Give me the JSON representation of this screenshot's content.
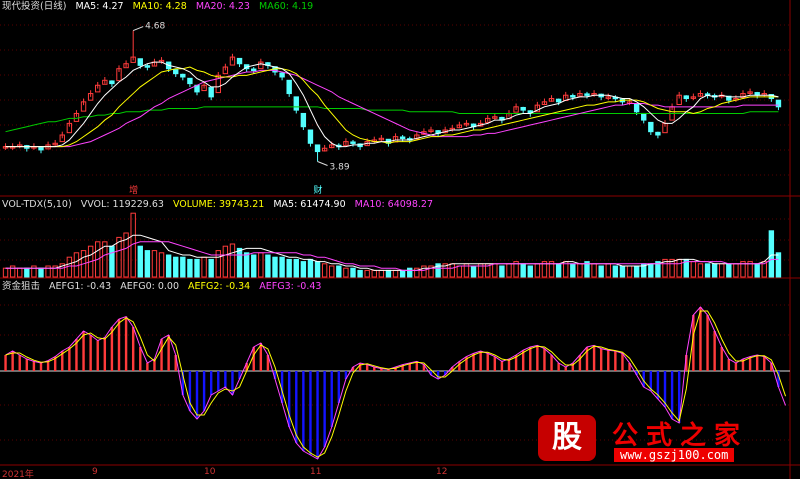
{
  "colors": {
    "up": "#ff3b3b",
    "down": "#54ffff",
    "ma5": "#ffffff",
    "ma10": "#ffff00",
    "ma20": "#ff44ff",
    "ma60": "#00cc00",
    "divider": "#8b0000",
    "blue": "#1414ff"
  },
  "price_header": {
    "title": "现代投资(日线)",
    "ma5": "MA5: 4.27",
    "ma10": "MA10: 4.28",
    "ma20": "MA20: 4.23",
    "ma60": "MA60: 4.19"
  },
  "vol_header": {
    "title": "VOL-TDX(5,10)",
    "vvol": "VVOL: 119229.63",
    "volume": "VOLUME: 39743.21",
    "ma5": "MA5: 61474.90",
    "ma10": "MA10: 64098.27"
  },
  "ind_header": {
    "title": "资金狙击",
    "g1": "AEFG1: -0.43",
    "g0": "AEFG0: 0.00",
    "g2": "AEFG2: -0.34",
    "g3": "AEFG3: -0.43"
  },
  "x_ticks": [
    "2021年",
    "9",
    "10",
    "11",
    "12"
  ],
  "markers": {
    "high": "4.68",
    "low": "3.89",
    "note1": "增",
    "note2": "财"
  },
  "watermark": {
    "char": "股",
    "name": "公式之家",
    "url": "www.gszj100.com"
  },
  "chart_data": [
    {
      "type": "candlestick",
      "title": "现代投资(日线)",
      "ylim": [
        3.7,
        4.78
      ],
      "close": [
        3.98,
        3.98,
        3.99,
        3.97,
        3.98,
        3.96,
        3.99,
        4.0,
        4.05,
        4.12,
        4.18,
        4.25,
        4.3,
        4.35,
        4.38,
        4.36,
        4.45,
        4.48,
        4.52,
        4.47,
        4.46,
        4.49,
        4.5,
        4.45,
        4.42,
        4.4,
        4.36,
        4.31,
        4.35,
        4.28,
        4.41,
        4.46,
        4.52,
        4.48,
        4.45,
        4.44,
        4.49,
        4.47,
        4.43,
        4.4,
        4.3,
        4.2,
        4.1,
        4.0,
        3.95,
        3.97,
        3.99,
        3.98,
        4.01,
        4.0,
        3.98,
        4.01,
        4.02,
        4.03,
        4.0,
        4.04,
        4.03,
        4.02,
        4.05,
        4.07,
        4.08,
        4.06,
        4.08,
        4.09,
        4.11,
        4.12,
        4.1,
        4.12,
        4.15,
        4.16,
        4.14,
        4.18,
        4.22,
        4.2,
        4.18,
        4.23,
        4.25,
        4.27,
        4.25,
        4.29,
        4.28,
        4.3,
        4.29,
        4.3,
        4.28,
        4.28,
        4.27,
        4.25,
        4.25,
        4.19,
        4.14,
        4.07,
        4.05,
        4.12,
        4.22,
        4.29,
        4.27,
        4.28,
        4.3,
        4.29,
        4.28,
        4.29,
        4.26,
        4.27,
        4.3,
        4.31,
        4.29,
        4.3,
        4.27,
        4.22
      ],
      "high": [
        4.0,
        4.0,
        4.01,
        3.99,
        4.0,
        3.98,
        4.01,
        4.02,
        4.07,
        4.14,
        4.2,
        4.27,
        4.32,
        4.37,
        4.4,
        4.38,
        4.47,
        4.5,
        4.68,
        4.49,
        4.48,
        4.51,
        4.52,
        4.47,
        4.44,
        4.42,
        4.38,
        4.33,
        4.37,
        4.3,
        4.43,
        4.48,
        4.54,
        4.5,
        4.47,
        4.46,
        4.51,
        4.49,
        4.45,
        4.42,
        4.32,
        4.22,
        4.12,
        4.02,
        3.97,
        3.99,
        4.01,
        4.0,
        4.03,
        4.02,
        4.0,
        4.03,
        4.04,
        4.05,
        4.02,
        4.06,
        4.05,
        4.04,
        4.07,
        4.09,
        4.1,
        4.08,
        4.1,
        4.11,
        4.13,
        4.14,
        4.12,
        4.14,
        4.17,
        4.18,
        4.16,
        4.2,
        4.24,
        4.22,
        4.2,
        4.25,
        4.27,
        4.29,
        4.27,
        4.31,
        4.3,
        4.32,
        4.31,
        4.32,
        4.3,
        4.3,
        4.29,
        4.27,
        4.27,
        4.21,
        4.16,
        4.09,
        4.07,
        4.14,
        4.24,
        4.31,
        4.29,
        4.3,
        4.32,
        4.31,
        4.3,
        4.31,
        4.28,
        4.29,
        4.32,
        4.33,
        4.31,
        4.32,
        4.29,
        4.24
      ],
      "low": [
        3.96,
        3.96,
        3.97,
        3.95,
        3.96,
        3.94,
        3.97,
        3.98,
        4.03,
        4.1,
        4.16,
        4.23,
        4.28,
        4.33,
        4.36,
        4.34,
        4.43,
        4.46,
        4.5,
        4.45,
        4.44,
        4.47,
        4.48,
        4.43,
        4.4,
        4.38,
        4.34,
        4.29,
        4.33,
        4.26,
        4.39,
        4.44,
        4.5,
        4.46,
        4.43,
        4.42,
        4.47,
        4.45,
        4.41,
        4.38,
        4.28,
        4.18,
        4.08,
        3.98,
        3.89,
        3.95,
        3.97,
        3.96,
        3.99,
        3.98,
        3.96,
        3.99,
        4.0,
        4.01,
        3.98,
        4.02,
        4.01,
        4.0,
        4.03,
        4.05,
        4.06,
        4.04,
        4.06,
        4.07,
        4.09,
        4.1,
        4.08,
        4.1,
        4.13,
        4.14,
        4.12,
        4.16,
        4.2,
        4.18,
        4.16,
        4.21,
        4.23,
        4.25,
        4.23,
        4.27,
        4.26,
        4.28,
        4.27,
        4.28,
        4.26,
        4.26,
        4.25,
        4.23,
        4.23,
        4.17,
        4.12,
        4.05,
        4.03,
        4.1,
        4.2,
        4.27,
        4.25,
        4.26,
        4.28,
        4.27,
        4.26,
        4.27,
        4.24,
        4.25,
        4.28,
        4.29,
        4.27,
        4.28,
        4.25,
        4.2
      ],
      "ma5": [
        3.98,
        3.98,
        3.98,
        3.98,
        3.98,
        3.98,
        3.98,
        3.98,
        3.99,
        4.02,
        4.07,
        4.12,
        4.18,
        4.24,
        4.29,
        4.33,
        4.37,
        4.4,
        4.44,
        4.46,
        4.48,
        4.49,
        4.49,
        4.47,
        4.46,
        4.45,
        4.43,
        4.39,
        4.37,
        4.34,
        4.34,
        4.36,
        4.4,
        4.43,
        4.46,
        4.47,
        4.48,
        4.47,
        4.46,
        4.45,
        4.42,
        4.36,
        4.29,
        4.2,
        4.11,
        4.04,
        4.0,
        3.98,
        3.98,
        3.99,
        3.99,
        4.0,
        4.0,
        4.01,
        4.01,
        4.02,
        4.02,
        4.02,
        4.03,
        4.04,
        4.05,
        4.06,
        4.07,
        4.08,
        4.08,
        4.09,
        4.1,
        4.11,
        4.12,
        4.14,
        4.14,
        4.15,
        4.17,
        4.18,
        4.18,
        4.2,
        4.22,
        4.23,
        4.24,
        4.26,
        4.27,
        4.28,
        4.28,
        4.29,
        4.29,
        4.29,
        4.28,
        4.27,
        4.27,
        4.25,
        4.22,
        4.18,
        4.14,
        4.12,
        4.12,
        4.15,
        4.19,
        4.22,
        4.27,
        4.29,
        4.28,
        4.29,
        4.28,
        4.28,
        4.28,
        4.29,
        4.29,
        4.29,
        4.29,
        4.28
      ],
      "ma10": [
        3.98,
        3.98,
        3.98,
        3.98,
        3.98,
        3.98,
        3.98,
        3.98,
        3.98,
        3.99,
        4.01,
        4.04,
        4.07,
        4.1,
        4.14,
        4.17,
        4.22,
        4.26,
        4.3,
        4.34,
        4.37,
        4.4,
        4.43,
        4.44,
        4.45,
        4.45,
        4.46,
        4.44,
        4.43,
        4.41,
        4.4,
        4.4,
        4.4,
        4.41,
        4.41,
        4.42,
        4.43,
        4.44,
        4.45,
        4.45,
        4.44,
        4.42,
        4.38,
        4.33,
        4.29,
        4.23,
        4.18,
        4.13,
        4.08,
        4.05,
        4.03,
        4.02,
        4.01,
        4.01,
        4.0,
        4.01,
        4.01,
        4.01,
        4.02,
        4.03,
        4.04,
        4.04,
        4.05,
        4.05,
        4.06,
        4.07,
        4.08,
        4.08,
        4.09,
        4.1,
        4.11,
        4.12,
        4.13,
        4.14,
        4.15,
        4.16,
        4.17,
        4.18,
        4.19,
        4.2,
        4.21,
        4.22,
        4.23,
        4.23,
        4.24,
        4.25,
        4.25,
        4.26,
        4.26,
        4.26,
        4.25,
        4.23,
        4.21,
        4.2,
        4.19,
        4.19,
        4.19,
        4.18,
        4.19,
        4.21,
        4.22,
        4.24,
        4.25,
        4.26,
        4.27,
        4.28,
        4.28,
        4.28,
        4.28,
        4.28
      ],
      "ma20": [
        3.98,
        3.98,
        3.98,
        3.98,
        3.98,
        3.98,
        3.98,
        3.98,
        3.98,
        3.98,
        3.99,
        4.0,
        4.01,
        4.03,
        4.05,
        4.07,
        4.09,
        4.12,
        4.14,
        4.16,
        4.19,
        4.22,
        4.24,
        4.27,
        4.29,
        4.31,
        4.33,
        4.35,
        4.37,
        4.38,
        4.39,
        4.4,
        4.41,
        4.42,
        4.43,
        4.43,
        4.44,
        4.44,
        4.44,
        4.43,
        4.42,
        4.41,
        4.39,
        4.37,
        4.35,
        4.33,
        4.31,
        4.28,
        4.26,
        4.24,
        4.22,
        4.2,
        4.18,
        4.16,
        4.14,
        4.12,
        4.1,
        4.08,
        4.07,
        4.06,
        4.05,
        4.04,
        4.04,
        4.04,
        4.04,
        4.04,
        4.05,
        4.05,
        4.06,
        4.06,
        4.07,
        4.08,
        4.09,
        4.1,
        4.11,
        4.12,
        4.13,
        4.14,
        4.15,
        4.16,
        4.17,
        4.18,
        4.19,
        4.2,
        4.21,
        4.22,
        4.23,
        4.23,
        4.24,
        4.24,
        4.24,
        4.23,
        4.23,
        4.22,
        4.22,
        4.22,
        4.22,
        4.22,
        4.22,
        4.22,
        4.22,
        4.22,
        4.22,
        4.22,
        4.23,
        4.23,
        4.23,
        4.23,
        4.23,
        4.23
      ],
      "ma60": [
        4.07,
        4.08,
        4.09,
        4.1,
        4.11,
        4.12,
        4.13,
        4.13,
        4.14,
        4.15,
        4.15,
        4.16,
        4.16,
        4.17,
        4.17,
        4.18,
        4.18,
        4.19,
        4.19,
        4.19,
        4.2,
        4.2,
        4.2,
        4.21,
        4.21,
        4.21,
        4.21,
        4.21,
        4.22,
        4.22,
        4.22,
        4.22,
        4.22,
        4.22,
        4.22,
        4.22,
        4.22,
        4.22,
        4.22,
        4.22,
        4.22,
        4.22,
        4.22,
        4.22,
        4.22,
        4.21,
        4.21,
        4.21,
        4.21,
        4.21,
        4.21,
        4.2,
        4.2,
        4.2,
        4.2,
        4.2,
        4.2,
        4.19,
        4.19,
        4.19,
        4.19,
        4.19,
        4.19,
        4.19,
        4.18,
        4.18,
        4.18,
        4.18,
        4.18,
        4.18,
        4.18,
        4.18,
        4.18,
        4.18,
        4.18,
        4.18,
        4.18,
        4.18,
        4.18,
        4.18,
        4.18,
        4.18,
        4.18,
        4.18,
        4.18,
        4.18,
        4.18,
        4.18,
        4.18,
        4.18,
        4.18,
        4.18,
        4.18,
        4.18,
        4.18,
        4.18,
        4.18,
        4.18,
        4.18,
        4.18,
        4.18,
        4.18,
        4.18,
        4.18,
        4.18,
        4.19,
        4.19,
        4.19,
        4.19,
        4.19
      ]
    },
    {
      "type": "bar",
      "title": "VOL-TDX(5,10)",
      "volume": [
        4,
        5,
        4,
        4,
        5,
        4,
        5,
        5,
        6,
        9,
        11,
        12,
        14,
        16,
        16,
        14,
        18,
        20,
        29,
        14,
        12,
        12,
        11,
        10,
        9,
        9,
        8,
        8,
        9,
        8,
        12,
        14,
        15,
        13,
        11,
        10,
        11,
        10,
        9,
        9,
        8,
        8,
        7,
        8,
        7,
        6,
        5,
        5,
        4,
        4,
        3,
        3,
        3,
        3,
        3,
        3,
        3,
        4,
        4,
        5,
        5,
        6,
        6,
        6,
        5,
        6,
        5,
        6,
        6,
        6,
        5,
        6,
        7,
        6,
        5,
        6,
        7,
        7,
        6,
        7,
        6,
        6,
        7,
        6,
        5,
        6,
        5,
        5,
        5,
        5,
        6,
        6,
        7,
        8,
        8,
        8,
        8,
        7,
        6,
        6,
        6,
        6,
        6,
        6,
        7,
        7,
        6,
        7,
        21,
        11
      ],
      "ma5": [
        4,
        4,
        4,
        4,
        4,
        4,
        4,
        4,
        5,
        6,
        7,
        9,
        10,
        12,
        14,
        14,
        16,
        17,
        19,
        19,
        18,
        17,
        16,
        12,
        11,
        10,
        10,
        9,
        9,
        9,
        9,
        10,
        11,
        12,
        13,
        13,
        13,
        12,
        11,
        10,
        9,
        9,
        8,
        8,
        7,
        7,
        6,
        6,
        5,
        5,
        4,
        4,
        3,
        3,
        3,
        3,
        3,
        3,
        3,
        4,
        4,
        5,
        5,
        6,
        6,
        6,
        6,
        6,
        6,
        6,
        6,
        6,
        6,
        6,
        6,
        6,
        6,
        6,
        6,
        7,
        7,
        6,
        6,
        6,
        6,
        6,
        6,
        5,
        5,
        5,
        5,
        6,
        6,
        7,
        7,
        8,
        8,
        8,
        7,
        7,
        6,
        6,
        6,
        6,
        6,
        6,
        6,
        7,
        10,
        10
      ],
      "ma10": [
        4,
        4,
        4,
        4,
        4,
        4,
        4,
        4,
        4,
        5,
        5,
        6,
        7,
        8,
        10,
        11,
        12,
        13,
        15,
        16,
        16,
        16,
        16,
        16,
        15,
        14,
        13,
        12,
        11,
        10,
        10,
        10,
        10,
        10,
        10,
        11,
        11,
        11,
        11,
        11,
        11,
        11,
        10,
        10,
        9,
        9,
        8,
        7,
        6,
        6,
        5,
        5,
        5,
        4,
        4,
        4,
        3,
        3,
        3,
        3,
        4,
        4,
        4,
        4,
        5,
        5,
        5,
        5,
        5,
        6,
        6,
        6,
        6,
        6,
        6,
        6,
        6,
        6,
        6,
        6,
        6,
        6,
        6,
        6,
        6,
        6,
        6,
        6,
        6,
        6,
        6,
        6,
        6,
        6,
        6,
        6,
        7,
        7,
        7,
        7,
        7,
        7,
        6,
        6,
        6,
        6,
        6,
        6,
        8,
        8
      ]
    },
    {
      "type": "bar",
      "title": "资金狙击",
      "aefg1": [
        0.2,
        0.25,
        0.2,
        0.15,
        0.12,
        0.1,
        0.13,
        0.18,
        0.25,
        0.3,
        0.4,
        0.5,
        0.45,
        0.38,
        0.42,
        0.55,
        0.65,
        0.68,
        0.55,
        0.3,
        0.1,
        0.15,
        0.4,
        0.45,
        0.2,
        -0.3,
        -0.5,
        -0.6,
        -0.5,
        -0.3,
        -0.25,
        -0.2,
        -0.3,
        -0.1,
        0.1,
        0.3,
        0.35,
        0.2,
        -0.1,
        -0.4,
        -0.7,
        -0.9,
        -1.0,
        -1.05,
        -1.1,
        -0.95,
        -0.7,
        -0.4,
        -0.1,
        0.05,
        0.1,
        0.08,
        0.05,
        0.03,
        0.02,
        0.05,
        0.08,
        0.1,
        0.12,
        0.08,
        -0.05,
        -0.1,
        -0.05,
        0.05,
        0.12,
        0.18,
        0.22,
        0.25,
        0.22,
        0.18,
        0.12,
        0.15,
        0.2,
        0.26,
        0.3,
        0.32,
        0.28,
        0.2,
        0.1,
        0.05,
        0.1,
        0.2,
        0.3,
        0.32,
        0.28,
        0.26,
        0.25,
        0.22,
        0.1,
        -0.05,
        -0.2,
        -0.25,
        -0.35,
        -0.45,
        -0.6,
        -0.65,
        0.2,
        0.7,
        0.8,
        0.7,
        0.5,
        0.3,
        0.15,
        0.1,
        0.15,
        0.18,
        0.2,
        0.18,
        0.1,
        -0.2,
        -0.43
      ]
    }
  ]
}
